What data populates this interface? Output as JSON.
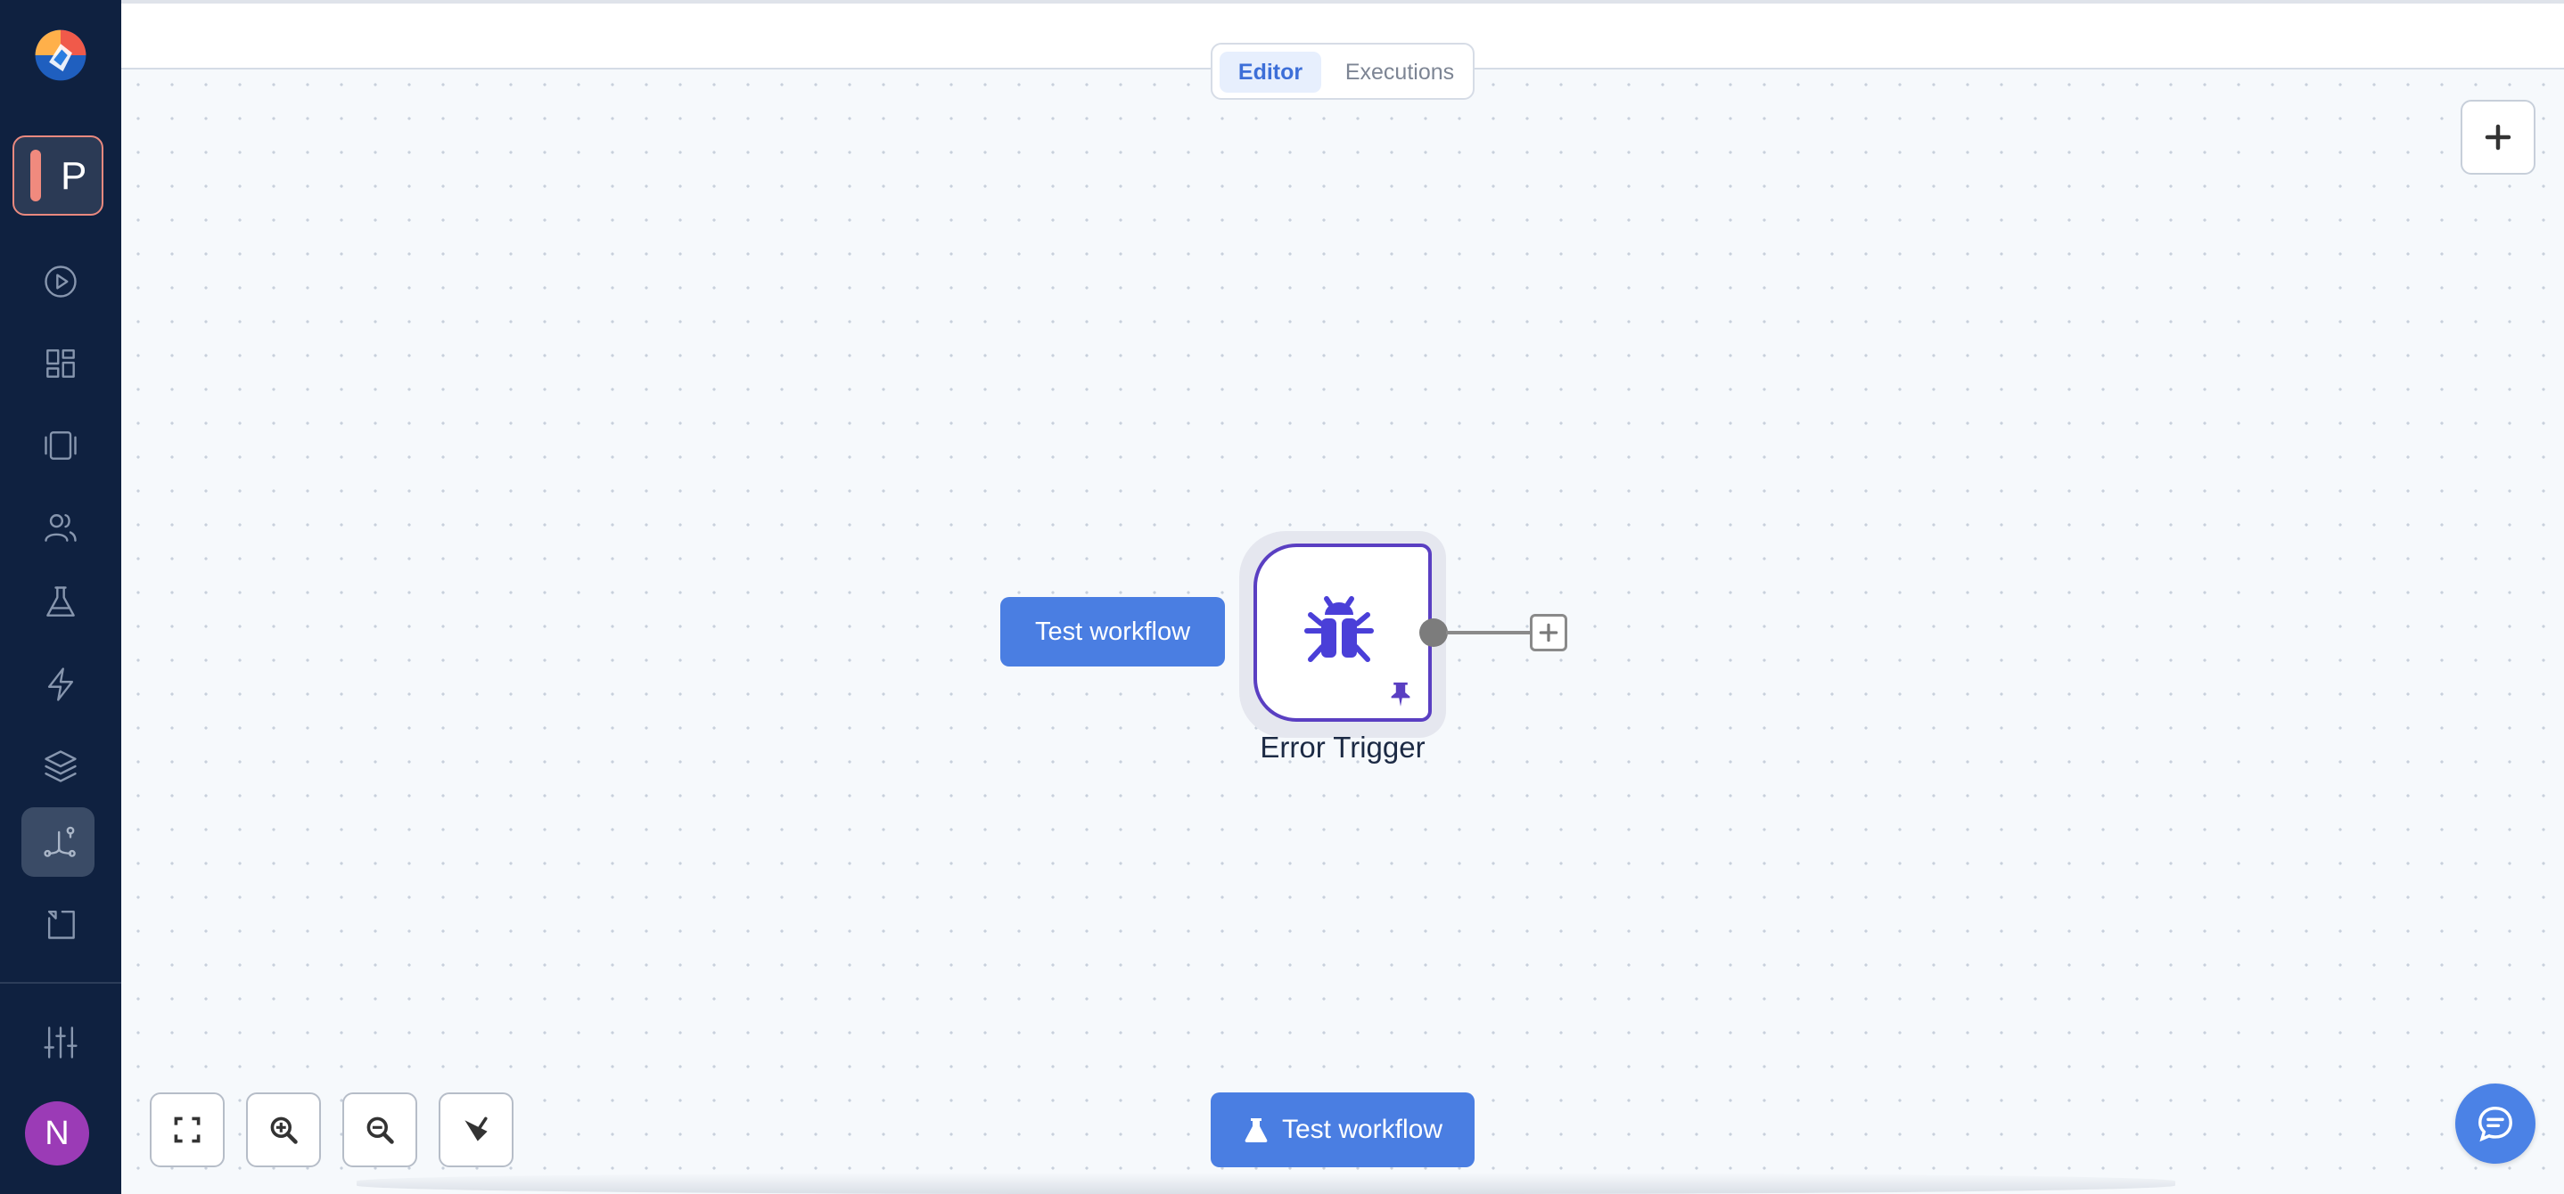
{
  "sidebar": {
    "project_letter": "P",
    "user_initial": "N",
    "nav_icons": [
      "play-circle-icon",
      "dashboard-icon",
      "templates-icon",
      "users-icon",
      "flask-icon",
      "lightning-icon",
      "layers-icon",
      "workflow-icon",
      "variables-icon",
      "settings-sliders-icon"
    ],
    "active_item": "workflow-icon"
  },
  "header": {
    "tabs": [
      {
        "label": "Editor",
        "active": true
      },
      {
        "label": "Executions",
        "active": false
      }
    ]
  },
  "canvas": {
    "node": {
      "label": "Error Trigger",
      "icon": "bug-icon",
      "pinned": true,
      "accent_color": "#4a3fd8"
    },
    "test_button_label": "Test workflow",
    "controls": [
      "fit-view-icon",
      "zoom-in-icon",
      "zoom-out-icon",
      "tidy-up-icon"
    ],
    "main_test_button_label": "Test workflow"
  },
  "colors": {
    "sidebar_bg": "#0f2140",
    "primary": "#4a7ee2",
    "node_border": "#5a3fc2"
  }
}
